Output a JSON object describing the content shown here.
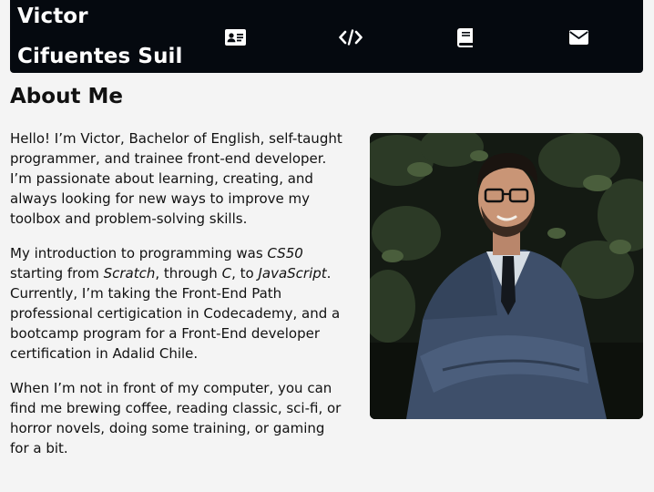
{
  "nav": {
    "brand_line1": "Victor",
    "brand_line2": "Cifuentes Suil",
    "items": [
      {
        "icon": "id-card-icon",
        "label": "About"
      },
      {
        "icon": "code-icon",
        "label": "Projects"
      },
      {
        "icon": "book-icon",
        "label": "Education"
      },
      {
        "icon": "envelope-icon",
        "label": "Contact"
      }
    ]
  },
  "about": {
    "title": "About Me",
    "p1": "Hello! I’m Victor, Bachelor of English, self-taught programmer, and trainee front-end developer. I’m passionate about learning, creating, and always looking for new ways to improve my toolbox and problem-solving skills.",
    "p2": {
      "t1": "My introduction to programming was ",
      "e1": "CS50",
      "t2": " starting from ",
      "e2": "Scratch",
      "t3": ", through ",
      "e3": "C",
      "t4": ", to ",
      "e4": "JavaScript",
      "t5": ". Currently, I’m taking the Front-End Path professional certigication in Codecademy, and a bootcamp program for a Front-End developer certification in Adalid Chile."
    },
    "p3": "When I’m not in front of my computer, you can find me brewing coffee, reading classic, sci-fi, or horror novels, doing some training, or gaming for a bit."
  },
  "colors": {
    "nav_bg": "#05090f",
    "page_bg": "#f4f4f4",
    "suit": "#3e4f6a"
  }
}
